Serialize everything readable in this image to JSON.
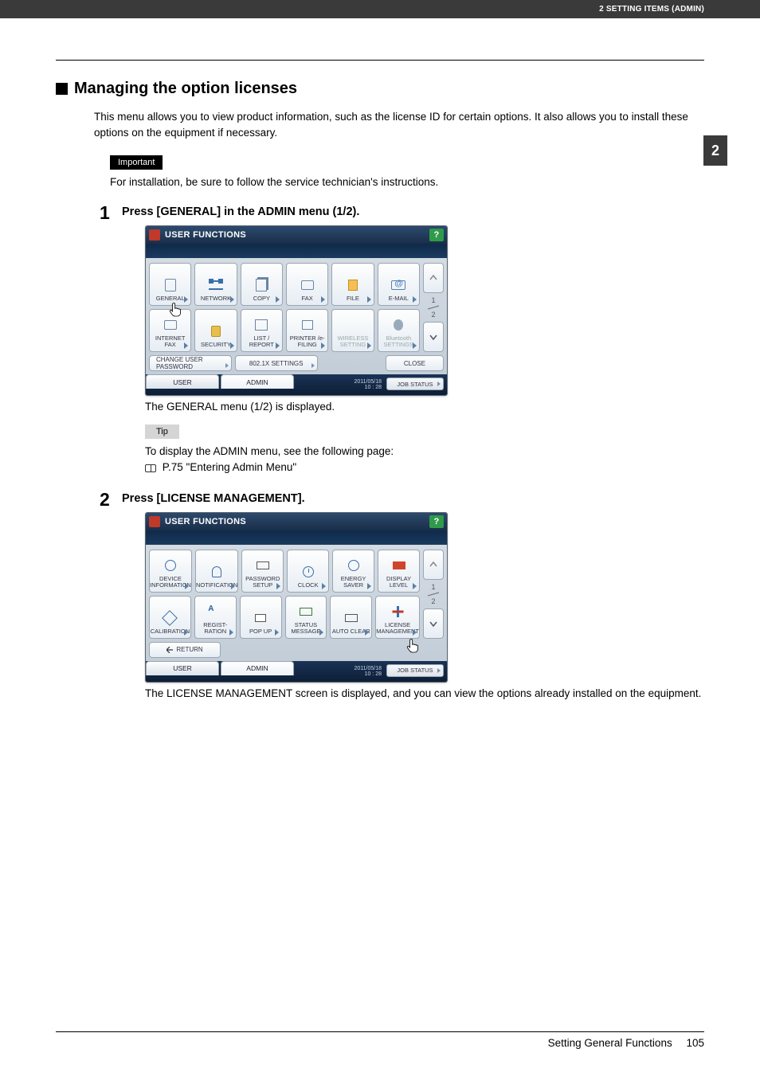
{
  "header": {
    "breadcrumb": "2 SETTING ITEMS (ADMIN)",
    "chapter_tab": "2"
  },
  "section": {
    "title": "Managing the option licenses",
    "intro": "This menu allows you to view product information, such as the license ID for certain options. It also allows you to install these options on the equipment if necessary."
  },
  "important": {
    "label": "Important",
    "text": "For installation, be sure to follow the service technician's instructions."
  },
  "steps": [
    {
      "num": "1",
      "heading": "Press [GENERAL] in the ADMIN menu (1/2).",
      "result": "The GENERAL menu (1/2) is displayed.",
      "tip": {
        "label": "Tip",
        "line1": "To display the ADMIN menu, see the following page:",
        "ref": "P.75 \"Entering Admin Menu\""
      }
    },
    {
      "num": "2",
      "heading": "Press [LICENSE MANAGEMENT].",
      "result": "The LICENSE MANAGEMENT screen is displayed, and you can view the options already installed on the equipment."
    }
  ],
  "panel_common": {
    "title": "USER FUNCTIONS",
    "help": "?",
    "page_indicator_top": "1",
    "page_indicator_bottom": "2",
    "tabs": {
      "user": "USER",
      "admin": "ADMIN"
    },
    "timestamp_line1": "2011/05/18",
    "timestamp_line2": "10 : 28",
    "job_status": "JOB STATUS"
  },
  "panel1": {
    "row1": [
      "GENERAL",
      "NETWORK",
      "COPY",
      "FAX",
      "FILE",
      "E-MAIL"
    ],
    "row2": [
      "INTERNET FAX",
      "SECURITY",
      "LIST / REPORT",
      "PRINTER /e-FILING",
      "WIRELESS SETTING",
      "Bluetooth SETTINGS"
    ],
    "bottom": {
      "change_pwd": "CHANGE USER PASSWORD",
      "x8021": "802.1X SETTINGS",
      "close": "CLOSE"
    }
  },
  "panel2": {
    "row1": [
      "DEVICE INFORMATION",
      "NOTIFICATION",
      "PASSWORD SETUP",
      "CLOCK",
      "ENERGY SAVER",
      "DISPLAY LEVEL"
    ],
    "row2": [
      "CALIBRATION",
      "REGIST- RATION",
      "POP UP",
      "STATUS MESSAGE",
      "AUTO CLEAR",
      "LICENSE MANAGEMENT"
    ],
    "return": "RETURN"
  },
  "footer": {
    "section": "Setting General Functions",
    "page": "105"
  }
}
